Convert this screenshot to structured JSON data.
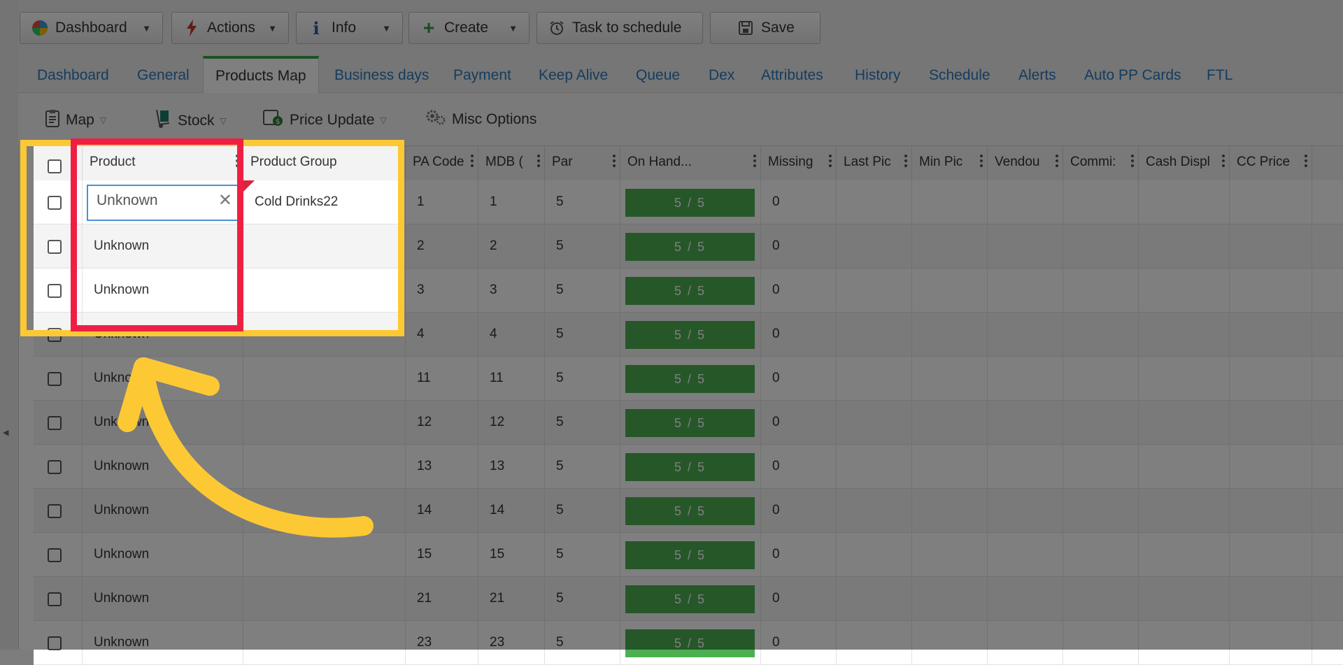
{
  "toolbar": {
    "dashboard": "Dashboard",
    "actions": "Actions",
    "info": "Info",
    "create": "Create",
    "task": "Task to schedule",
    "save": "Save"
  },
  "tabs": [
    "Dashboard",
    "General",
    "Products Map",
    "Business days",
    "Payment",
    "Keep Alive",
    "Queue",
    "Dex",
    "Attributes",
    "History",
    "Schedule",
    "Alerts",
    "Auto PP Cards",
    "FTL"
  ],
  "active_tab": "Products Map",
  "subbar": {
    "map": "Map",
    "stock": "Stock",
    "price_update": "Price Update",
    "misc": "Misc Options"
  },
  "grid": {
    "headers": [
      "Product",
      "Product Group",
      "PA Code",
      "MDB (",
      "Par",
      "On Hand...",
      "Missing",
      "Last Pic",
      "Min Pic",
      "Vendou",
      "Commi:",
      "Cash Displ",
      "CC Price"
    ],
    "editor_value": "Unknown",
    "rows": [
      {
        "product": "Unknown",
        "group": "Cold Drinks22",
        "pa": "1",
        "mdb": "1",
        "par": "5",
        "onhand": "5 / 5",
        "missing": "0"
      },
      {
        "product": "Unknown",
        "group": "",
        "pa": "2",
        "mdb": "2",
        "par": "5",
        "onhand": "5 / 5",
        "missing": "0"
      },
      {
        "product": "Unknown",
        "group": "",
        "pa": "3",
        "mdb": "3",
        "par": "5",
        "onhand": "5 / 5",
        "missing": "0"
      },
      {
        "product": "Unknown",
        "group": "",
        "pa": "4",
        "mdb": "4",
        "par": "5",
        "onhand": "5 / 5",
        "missing": "0"
      },
      {
        "product": "Unknown",
        "group": "",
        "pa": "11",
        "mdb": "11",
        "par": "5",
        "onhand": "5 / 5",
        "missing": "0"
      },
      {
        "product": "Unknown",
        "group": "",
        "pa": "12",
        "mdb": "12",
        "par": "5",
        "onhand": "5 / 5",
        "missing": "0"
      },
      {
        "product": "Unknown",
        "group": "",
        "pa": "13",
        "mdb": "13",
        "par": "5",
        "onhand": "5 / 5",
        "missing": "0"
      },
      {
        "product": "Unknown",
        "group": "",
        "pa": "14",
        "mdb": "14",
        "par": "5",
        "onhand": "5 / 5",
        "missing": "0"
      },
      {
        "product": "Unknown",
        "group": "",
        "pa": "15",
        "mdb": "15",
        "par": "5",
        "onhand": "5 / 5",
        "missing": "0"
      },
      {
        "product": "Unknown",
        "group": "",
        "pa": "21",
        "mdb": "21",
        "par": "5",
        "onhand": "5 / 5",
        "missing": "0"
      },
      {
        "product": "Unknown",
        "group": "",
        "pa": "23",
        "mdb": "23",
        "par": "5",
        "onhand": "5 / 5",
        "missing": "0"
      }
    ]
  },
  "colors": {
    "highlight_yellow": "#fcc934",
    "highlight_red": "#ef1f43",
    "onhand_green": "#4caf50",
    "tab_active_accent": "#3aa54a",
    "link_blue": "#2a78bd"
  },
  "icons": [
    "pie-chart-icon",
    "lightning-icon",
    "info-icon",
    "plus-icon",
    "alarm-clock-icon",
    "save-icon",
    "clipboard-icon",
    "hand-truck-icon",
    "price-tag-icon",
    "gears-icon",
    "kebab-menu-icon",
    "close-icon",
    "curved-arrow-annotation"
  ]
}
